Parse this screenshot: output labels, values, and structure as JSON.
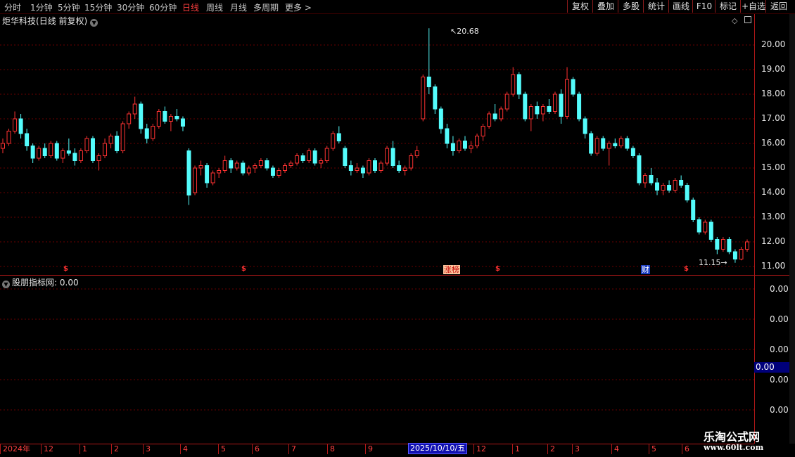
{
  "toolbar": {
    "period_tabs": [
      "分时",
      "1分钟",
      "5分钟",
      "15分钟",
      "30分钟",
      "60分钟",
      "日线",
      "周线",
      "月线",
      "多周期",
      "更多 >"
    ],
    "active_tab": "日线",
    "tool_buttons": [
      "复权",
      "叠加",
      "多股",
      "统计",
      "画线",
      "F10",
      "标记",
      "+自选",
      "返回"
    ]
  },
  "main_chart": {
    "stock_name": "炬华科技",
    "mode": "(日线 前复权)",
    "price_axis": [
      "20.00",
      "19.00",
      "18.00",
      "17.00",
      "16.00",
      "15.00",
      "14.00",
      "13.00",
      "12.00",
      "11.00"
    ],
    "high_annotation": "20.68",
    "low_annotation": "11.15",
    "event_tags": {
      "limit_up": "涨榜",
      "finance": "财"
    },
    "colors": {
      "up": "#ff3232",
      "down": "#54fcfc",
      "grid": "#6a0000",
      "axis": "#b01818"
    }
  },
  "chart_data": {
    "type": "candlestick",
    "ylim": [
      10.8,
      21.0
    ],
    "ohlc": [
      [
        15.8,
        16.2,
        15.6,
        16.0
      ],
      [
        16.0,
        16.6,
        15.9,
        16.5
      ],
      [
        16.5,
        17.3,
        16.4,
        17.0
      ],
      [
        17.0,
        17.2,
        16.2,
        16.4
      ],
      [
        16.4,
        16.6,
        15.7,
        15.9
      ],
      [
        15.9,
        16.0,
        15.2,
        15.4
      ],
      [
        15.4,
        15.9,
        15.3,
        15.8
      ],
      [
        15.8,
        16.0,
        15.4,
        15.5
      ],
      [
        15.5,
        16.1,
        15.4,
        16.0
      ],
      [
        16.0,
        16.1,
        15.3,
        15.4
      ],
      [
        15.4,
        15.8,
        15.2,
        15.7
      ],
      [
        15.7,
        16.2,
        15.5,
        15.6
      ],
      [
        15.6,
        15.8,
        15.1,
        15.3
      ],
      [
        15.3,
        15.8,
        15.2,
        15.7
      ],
      [
        15.7,
        16.3,
        15.6,
        16.2
      ],
      [
        16.2,
        16.3,
        15.2,
        15.3
      ],
      [
        15.3,
        15.6,
        14.9,
        15.5
      ],
      [
        15.5,
        16.2,
        15.4,
        16.0
      ],
      [
        16.0,
        16.4,
        15.8,
        16.3
      ],
      [
        16.3,
        16.5,
        15.6,
        15.7
      ],
      [
        15.7,
        16.9,
        15.6,
        16.8
      ],
      [
        16.8,
        17.3,
        16.6,
        17.2
      ],
      [
        17.2,
        17.9,
        17.0,
        17.6
      ],
      [
        17.6,
        17.7,
        16.4,
        16.6
      ],
      [
        16.6,
        16.8,
        16.0,
        16.2
      ],
      [
        16.2,
        16.8,
        16.1,
        16.7
      ],
      [
        16.7,
        17.4,
        16.6,
        17.3
      ],
      [
        17.3,
        17.5,
        16.8,
        16.9
      ],
      [
        16.9,
        17.2,
        16.5,
        17.1
      ],
      [
        17.1,
        17.4,
        16.9,
        17.0
      ],
      [
        17.0,
        17.1,
        16.5,
        16.7
      ],
      [
        15.7,
        15.8,
        13.5,
        13.9
      ],
      [
        14.0,
        15.1,
        13.9,
        15.0
      ],
      [
        15.0,
        15.3,
        14.7,
        15.1
      ],
      [
        15.1,
        15.2,
        14.2,
        14.4
      ],
      [
        14.4,
        14.9,
        14.3,
        14.8
      ],
      [
        14.8,
        15.0,
        14.6,
        14.9
      ],
      [
        14.9,
        15.5,
        14.8,
        15.3
      ],
      [
        15.3,
        15.4,
        14.8,
        15.0
      ],
      [
        15.0,
        15.3,
        14.9,
        15.2
      ],
      [
        15.2,
        15.3,
        14.7,
        14.8
      ],
      [
        14.8,
        15.1,
        14.7,
        15.0
      ],
      [
        15.0,
        15.2,
        14.8,
        15.1
      ],
      [
        15.1,
        15.4,
        15.0,
        15.3
      ],
      [
        15.3,
        15.4,
        14.9,
        15.0
      ],
      [
        15.0,
        15.1,
        14.6,
        14.7
      ],
      [
        14.7,
        15.0,
        14.6,
        14.9
      ],
      [
        14.9,
        15.2,
        14.8,
        15.1
      ],
      [
        15.1,
        15.3,
        15.0,
        15.2
      ],
      [
        15.2,
        15.6,
        15.1,
        15.5
      ],
      [
        15.5,
        15.6,
        15.2,
        15.3
      ],
      [
        15.3,
        15.8,
        15.2,
        15.7
      ],
      [
        15.7,
        15.8,
        15.1,
        15.2
      ],
      [
        15.2,
        15.4,
        15.0,
        15.3
      ],
      [
        15.3,
        15.9,
        15.2,
        15.8
      ],
      [
        15.8,
        16.5,
        15.7,
        16.4
      ],
      [
        16.4,
        16.7,
        16.0,
        16.1
      ],
      [
        15.8,
        15.9,
        15.0,
        15.1
      ],
      [
        15.1,
        15.3,
        14.7,
        14.9
      ],
      [
        14.9,
        15.2,
        14.8,
        15.0
      ],
      [
        15.0,
        15.1,
        14.6,
        14.8
      ],
      [
        14.8,
        15.4,
        14.7,
        15.3
      ],
      [
        15.3,
        15.4,
        14.8,
        14.9
      ],
      [
        14.9,
        15.3,
        14.8,
        15.2
      ],
      [
        15.2,
        15.9,
        15.1,
        15.8
      ],
      [
        15.8,
        16.1,
        15.0,
        15.1
      ],
      [
        15.1,
        15.3,
        14.8,
        14.9
      ],
      [
        14.9,
        15.1,
        14.7,
        15.0
      ],
      [
        15.0,
        15.6,
        14.9,
        15.5
      ],
      [
        15.5,
        15.9,
        15.4,
        15.7
      ],
      [
        17.0,
        18.8,
        16.9,
        18.7
      ],
      [
        18.7,
        20.68,
        18.0,
        18.3
      ],
      [
        18.3,
        18.4,
        17.2,
        17.4
      ],
      [
        17.4,
        17.5,
        16.4,
        16.6
      ],
      [
        16.6,
        16.8,
        15.8,
        16.0
      ],
      [
        16.0,
        16.3,
        15.5,
        15.7
      ],
      [
        15.7,
        16.2,
        15.6,
        16.1
      ],
      [
        16.1,
        16.3,
        15.7,
        15.8
      ],
      [
        15.8,
        16.1,
        15.6,
        15.9
      ],
      [
        15.9,
        16.4,
        15.8,
        16.3
      ],
      [
        16.3,
        16.8,
        16.1,
        16.7
      ],
      [
        16.7,
        17.3,
        16.6,
        17.2
      ],
      [
        17.2,
        17.6,
        16.9,
        17.0
      ],
      [
        17.0,
        17.5,
        16.9,
        17.4
      ],
      [
        17.4,
        18.1,
        17.3,
        18.0
      ],
      [
        18.0,
        19.1,
        17.9,
        18.8
      ],
      [
        18.8,
        18.9,
        17.8,
        18.0
      ],
      [
        18.0,
        18.1,
        16.9,
        17.0
      ],
      [
        17.0,
        17.6,
        16.5,
        17.5
      ],
      [
        17.5,
        17.7,
        17.0,
        17.2
      ],
      [
        17.2,
        17.6,
        16.9,
        17.5
      ],
      [
        17.5,
        17.8,
        17.2,
        17.3
      ],
      [
        17.3,
        18.1,
        17.2,
        18.0
      ],
      [
        18.0,
        18.2,
        16.8,
        17.1
      ],
      [
        17.1,
        19.1,
        17.0,
        18.6
      ],
      [
        18.6,
        18.7,
        17.9,
        18.0
      ],
      [
        18.0,
        18.1,
        16.9,
        17.0
      ],
      [
        17.0,
        17.1,
        16.2,
        16.4
      ],
      [
        16.4,
        16.5,
        15.5,
        15.6
      ],
      [
        15.6,
        16.3,
        15.5,
        16.2
      ],
      [
        16.2,
        16.3,
        15.7,
        15.8
      ],
      [
        15.8,
        16.1,
        15.1,
        16.0
      ],
      [
        16.0,
        16.2,
        15.8,
        15.9
      ],
      [
        15.9,
        16.3,
        15.8,
        16.2
      ],
      [
        16.2,
        16.3,
        15.7,
        15.8
      ],
      [
        15.8,
        15.9,
        15.4,
        15.5
      ],
      [
        15.5,
        15.6,
        14.3,
        14.4
      ],
      [
        14.4,
        14.8,
        14.2,
        14.7
      ],
      [
        14.7,
        15.0,
        14.3,
        14.4
      ],
      [
        14.4,
        14.6,
        13.9,
        14.1
      ],
      [
        14.1,
        14.4,
        13.9,
        14.3
      ],
      [
        14.3,
        14.5,
        14.0,
        14.1
      ],
      [
        14.1,
        14.6,
        14.0,
        14.5
      ],
      [
        14.5,
        14.7,
        14.2,
        14.3
      ],
      [
        14.3,
        14.4,
        13.6,
        13.7
      ],
      [
        13.7,
        13.8,
        12.8,
        12.9
      ],
      [
        12.9,
        13.0,
        12.3,
        12.4
      ],
      [
        12.4,
        12.9,
        12.3,
        12.8
      ],
      [
        12.8,
        12.9,
        12.0,
        12.1
      ],
      [
        12.1,
        12.2,
        11.5,
        11.7
      ],
      [
        11.7,
        12.2,
        11.6,
        12.1
      ],
      [
        12.1,
        12.2,
        11.5,
        11.6
      ],
      [
        11.6,
        11.7,
        11.15,
        11.3
      ],
      [
        11.3,
        11.8,
        11.25,
        11.7
      ],
      [
        11.7,
        12.1,
        11.6,
        12.0
      ]
    ]
  },
  "indicator": {
    "name": "股朋指标网",
    "value": ": 0.00",
    "axis_labels": [
      "0.00",
      "0.00",
      "0.00",
      "0.00",
      "0.00"
    ],
    "current": "0.00"
  },
  "datebar": {
    "ticks": [
      "2024年",
      "12",
      "1",
      "2",
      "3",
      "4",
      "5",
      "6",
      "7",
      "8",
      "9",
      "12",
      "1",
      "2",
      "3",
      "4",
      "5",
      "6"
    ],
    "cursor_date": "2025/10/10/五"
  },
  "watermark": {
    "title": "乐淘公式网",
    "url": "www.60lt.com"
  }
}
